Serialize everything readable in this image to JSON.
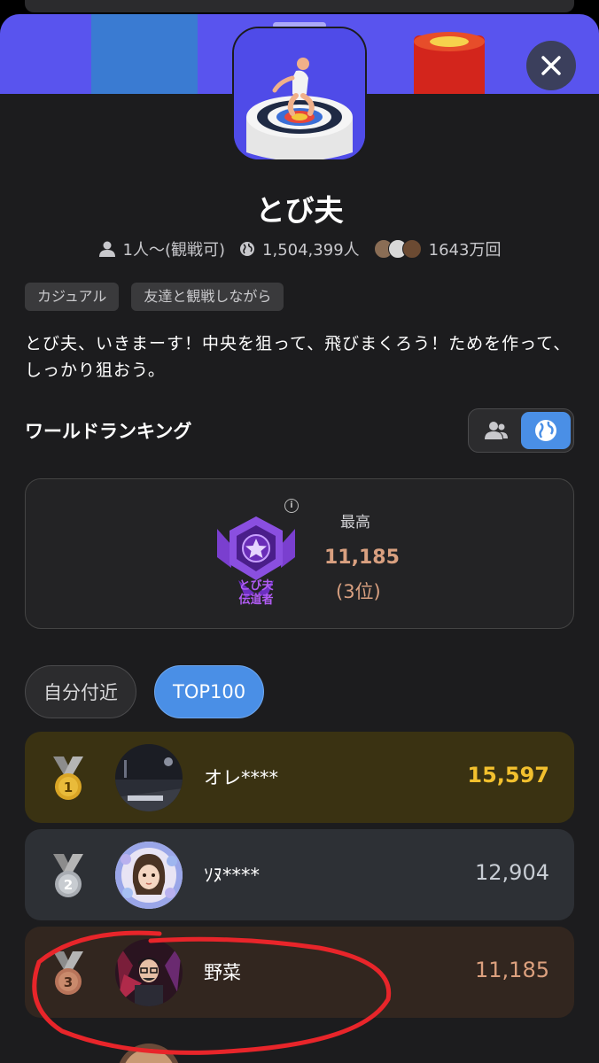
{
  "game": {
    "title": "とび夫",
    "players": "1人〜(観戦可)",
    "plays_total": "1,504,399人",
    "friend_plays": "1643万回",
    "tags": [
      "カジュアル",
      "友達と観戦しながら"
    ],
    "description": "とび夫、いきまーす！中央を狙って、飛びまくろう！ためを作って、しっかり狙おう。"
  },
  "ranking": {
    "section_title": "ワールドランキング",
    "best_label": "最高",
    "best_score": "11,185",
    "best_rank": "(3位)",
    "badge_caption_line1": "とび夫",
    "badge_caption_line2": "伝道者",
    "tabs": [
      {
        "label": "自分付近",
        "active": false
      },
      {
        "label": "TOP100",
        "active": true
      }
    ],
    "rows": [
      {
        "rank": "1",
        "name": "オレ****",
        "score": "15,597",
        "medal": "gold"
      },
      {
        "rank": "2",
        "name": "ｿﾇ****",
        "score": "12,904",
        "medal": "silver"
      },
      {
        "rank": "3",
        "name": "野菜",
        "score": "11,185",
        "medal": "bronze"
      }
    ]
  },
  "icons": {
    "close": "close-icon",
    "person": "person-icon",
    "globe": "globe-icon",
    "friends": "friends-icon",
    "info": "info-icon"
  },
  "colors": {
    "accent_blue": "#4a8fe6",
    "banner_purple": "#5954ee",
    "gold": "#f2c02e",
    "bronze_text": "#dca07e",
    "highlight_red": "#e8252a"
  }
}
